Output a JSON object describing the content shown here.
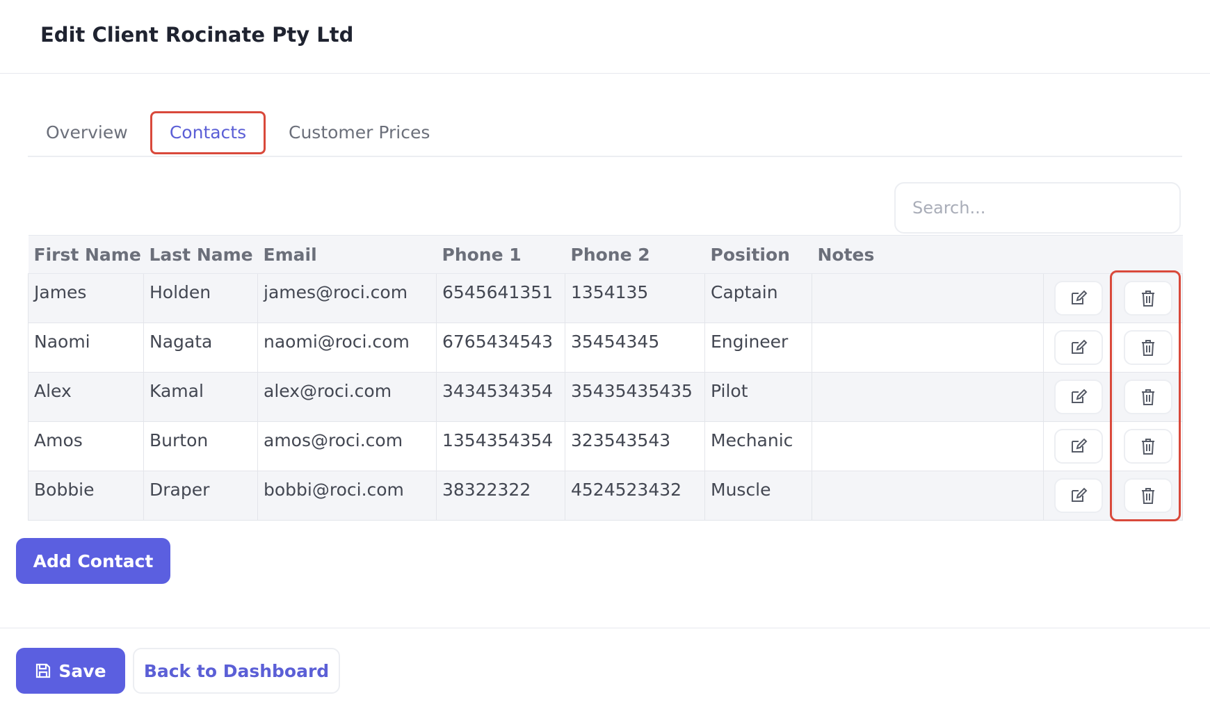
{
  "page": {
    "title": "Edit Client Rocinate Pty Ltd"
  },
  "tabs": [
    {
      "label": "Overview",
      "active": false
    },
    {
      "label": "Contacts",
      "active": true
    },
    {
      "label": "Customer Prices",
      "active": false
    }
  ],
  "search": {
    "placeholder": "Search...",
    "value": ""
  },
  "table": {
    "columns": [
      "First Name",
      "Last Name",
      "Email",
      "Phone 1",
      "Phone 2",
      "Position",
      "Notes"
    ],
    "rows": [
      {
        "first_name": "James",
        "last_name": "Holden",
        "email": "james@roci.com",
        "phone1": "6545641351",
        "phone2": "1354135",
        "position": "Captain",
        "notes": ""
      },
      {
        "first_name": "Naomi",
        "last_name": "Nagata",
        "email": "naomi@roci.com",
        "phone1": "6765434543",
        "phone2": "35454345",
        "position": "Engineer",
        "notes": ""
      },
      {
        "first_name": "Alex",
        "last_name": "Kamal",
        "email": "alex@roci.com",
        "phone1": "3434534354",
        "phone2": "35435435435",
        "position": "Pilot",
        "notes": ""
      },
      {
        "first_name": "Amos",
        "last_name": "Burton",
        "email": "amos@roci.com",
        "phone1": "1354354354",
        "phone2": "323543543",
        "position": "Mechanic",
        "notes": ""
      },
      {
        "first_name": "Bobbie",
        "last_name": "Draper",
        "email": "bobbi@roci.com",
        "phone1": "38322322",
        "phone2": "4524523432",
        "position": "Muscle",
        "notes": ""
      }
    ],
    "row_actions": {
      "edit_icon": "edit-icon",
      "delete_icon": "trash-icon"
    }
  },
  "actions": {
    "add_contact_label": "Add Contact",
    "save_label": "Save",
    "save_icon": "save-icon",
    "back_label": "Back to Dashboard"
  },
  "colors": {
    "primary": "#5b5fe0",
    "highlight": "#d9493b"
  }
}
